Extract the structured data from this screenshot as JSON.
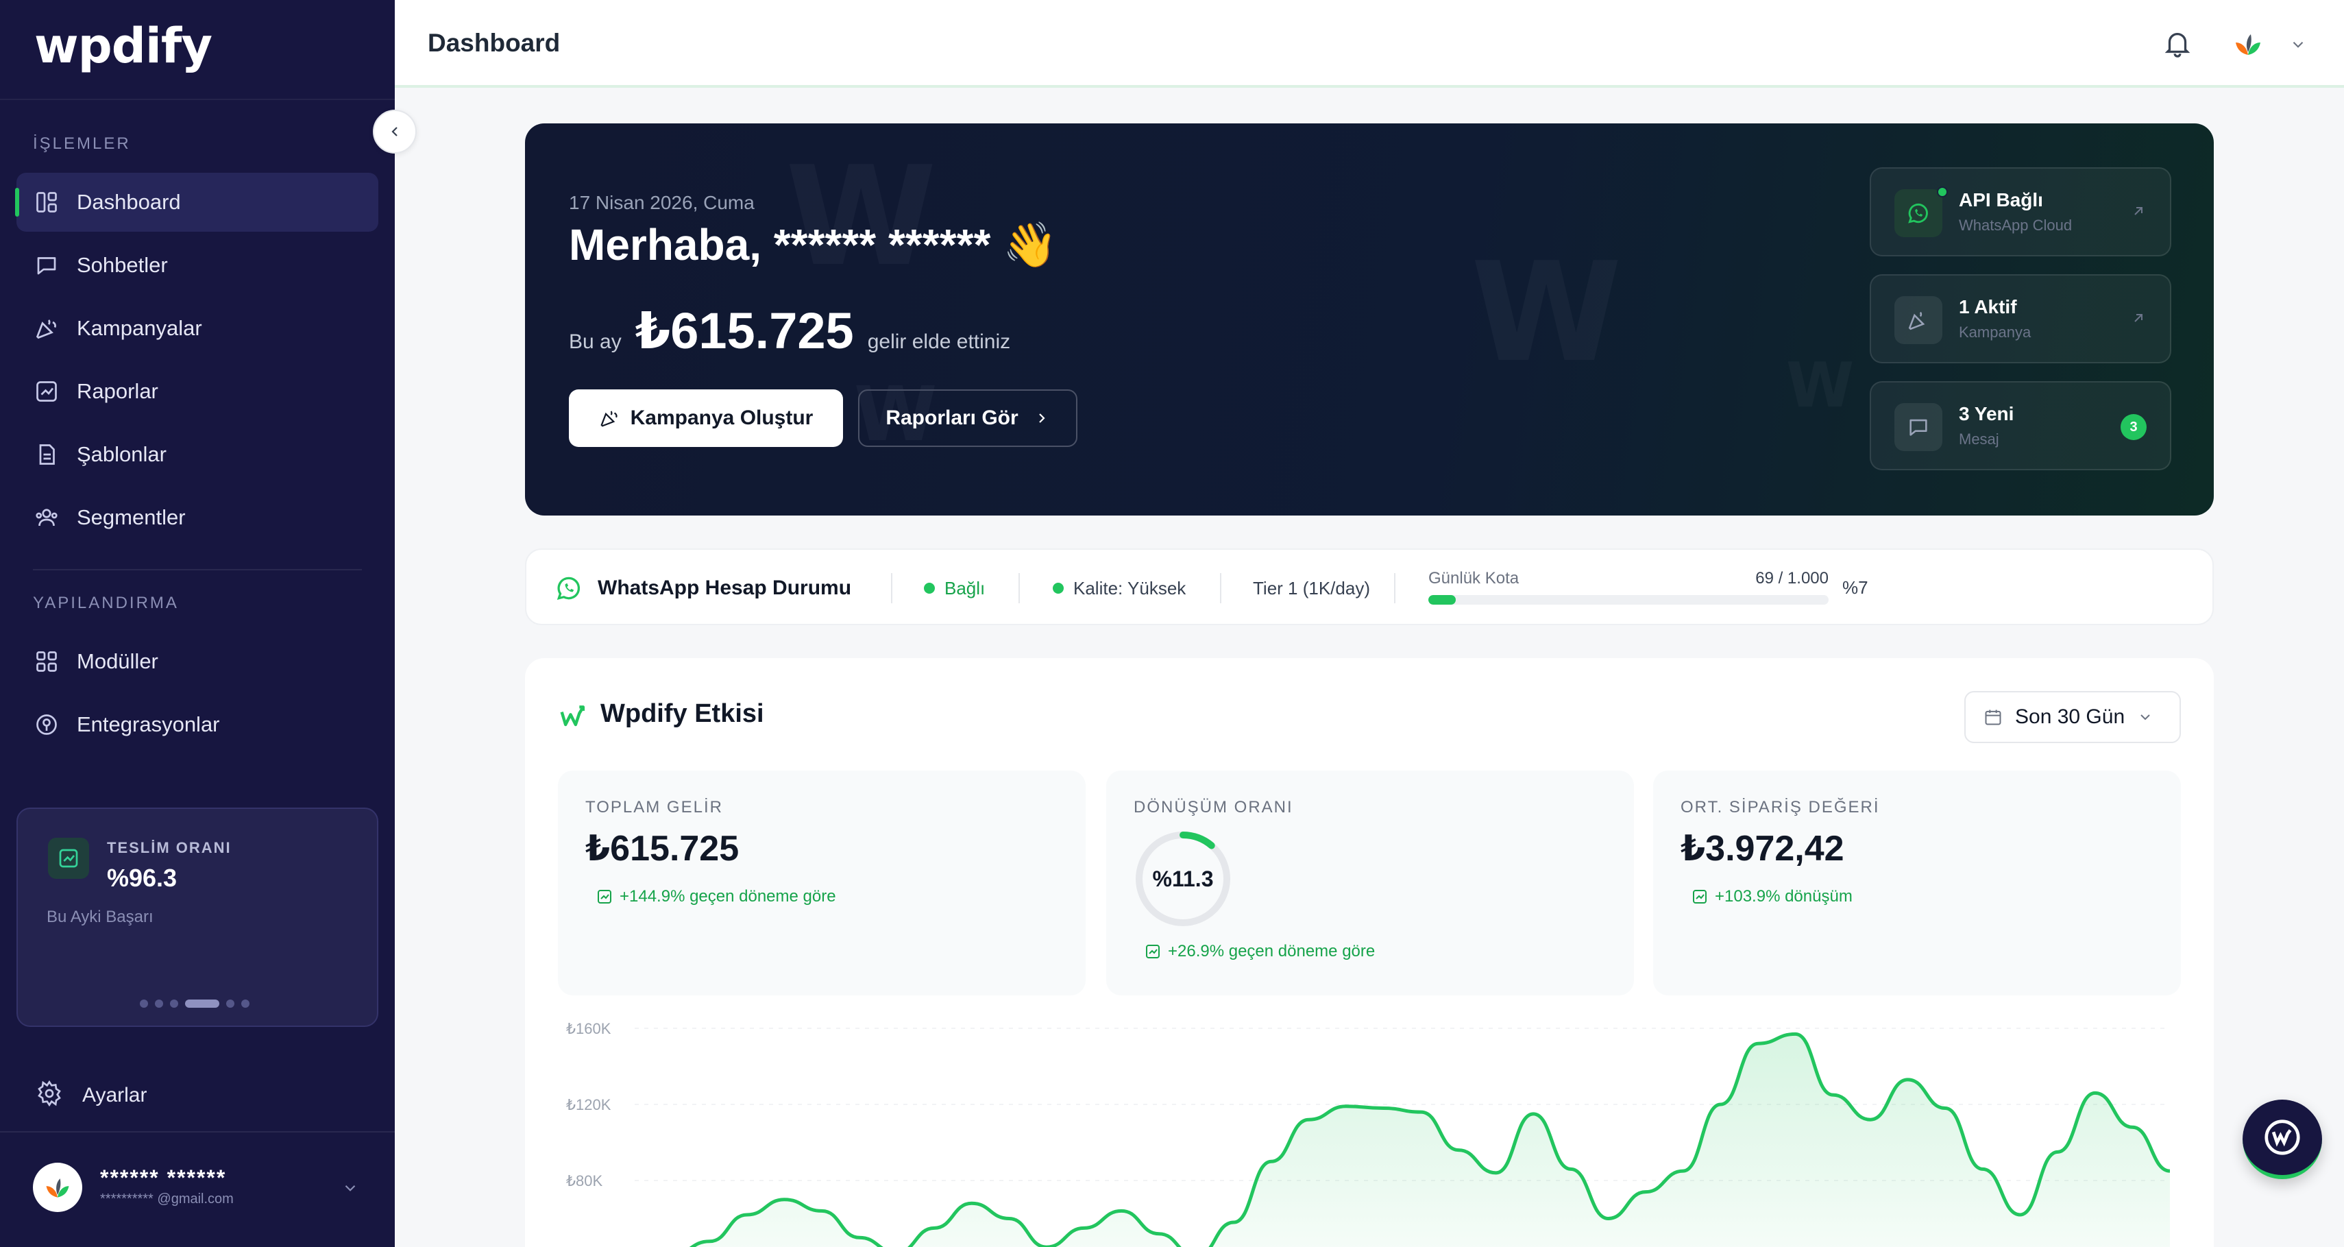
{
  "app": {
    "logo": "wpdify"
  },
  "sidebar": {
    "section_operations": "İŞLEMLER",
    "section_config": "YAPILANDIRMA",
    "items": [
      {
        "label": "Dashboard",
        "icon": "dashboard-icon"
      },
      {
        "label": "Sohbetler",
        "icon": "chat-icon"
      },
      {
        "label": "Kampanyalar",
        "icon": "megaphone-icon"
      },
      {
        "label": "Raporlar",
        "icon": "report-icon"
      },
      {
        "label": "Şablonlar",
        "icon": "template-icon"
      },
      {
        "label": "Segmentler",
        "icon": "users-icon"
      }
    ],
    "config_items": [
      {
        "label": "Modüller",
        "icon": "grid-icon"
      },
      {
        "label": "Entegrasyonlar",
        "icon": "integration-icon"
      }
    ],
    "delivery": {
      "label": "TESLİM ORANI",
      "value": "%96.3",
      "sub": "Bu Ayki Başarı"
    },
    "settings_label": "Ayarlar",
    "user": {
      "name": "****** ******",
      "email": "********** @gmail.com"
    }
  },
  "topbar": {
    "title": "Dashboard"
  },
  "hero": {
    "date": "17 Nisan 2026, Cuma",
    "greeting": "Merhaba, ****** ****** 👋",
    "month_label": "Bu ay",
    "month_value": "₺615.725",
    "month_suffix": "gelir elde ettiniz",
    "primary_button": "Kampanya Oluştur",
    "secondary_button": "Raporları Gör",
    "cards": [
      {
        "title": "API Bağlı",
        "sub": "WhatsApp Cloud"
      },
      {
        "title": "1 Aktif",
        "sub": "Kampanya"
      },
      {
        "title": "3 Yeni",
        "sub": "Mesaj",
        "badge": "3"
      }
    ]
  },
  "status": {
    "title": "WhatsApp Hesap Durumu",
    "connected": "Bağlı",
    "quality": "Kalite: Yüksek",
    "tier": "Tier 1 (1K/day)",
    "quota_label": "Günlük Kota",
    "quota_value": "69 / 1.000",
    "quota_pct": "%7",
    "quota_fraction": 0.069
  },
  "effect": {
    "title": "Wpdify Etkisi",
    "range": "Son 30 Gün",
    "metrics": [
      {
        "label": "TOPLAM GELİR",
        "value": "₺615.725",
        "change": "+144.9% geçen döneme göre"
      },
      {
        "label": "DÖNÜŞÜM ORANI",
        "value": "%11.3",
        "change": "+26.9% geçen döneme göre",
        "ring_fraction": 0.113
      },
      {
        "label": "ORT. SİPARİŞ DEĞERİ",
        "value": "₺3.972,42",
        "change": "+103.9% dönüşüm"
      }
    ]
  },
  "chart_data": {
    "type": "area",
    "y_ticks": [
      "₺160K",
      "₺120K",
      "₺80K"
    ],
    "ylim": [
      40000,
      160000
    ],
    "x": [
      1,
      2,
      3,
      4,
      5,
      6,
      7,
      8,
      9,
      10,
      11,
      12,
      13,
      14,
      15,
      16,
      17,
      18,
      19,
      20,
      21,
      22,
      23,
      24,
      25,
      26,
      27,
      28,
      29,
      30,
      31,
      32,
      33,
      34,
      35,
      36,
      37,
      38,
      39,
      40,
      41,
      42
    ],
    "values": [
      40000,
      41000,
      48000,
      62000,
      70000,
      64000,
      50000,
      42000,
      55000,
      68000,
      60000,
      45000,
      55000,
      64000,
      52000,
      40000,
      58000,
      90000,
      112000,
      119000,
      118000,
      116000,
      96000,
      84000,
      115000,
      86000,
      60000,
      74000,
      85000,
      120000,
      152000,
      157000,
      125000,
      112000,
      133000,
      118000,
      86000,
      62000,
      95000,
      126000,
      108000,
      85000
    ],
    "colors": {
      "line": "#22c55e",
      "fill": "#22c55e"
    }
  }
}
